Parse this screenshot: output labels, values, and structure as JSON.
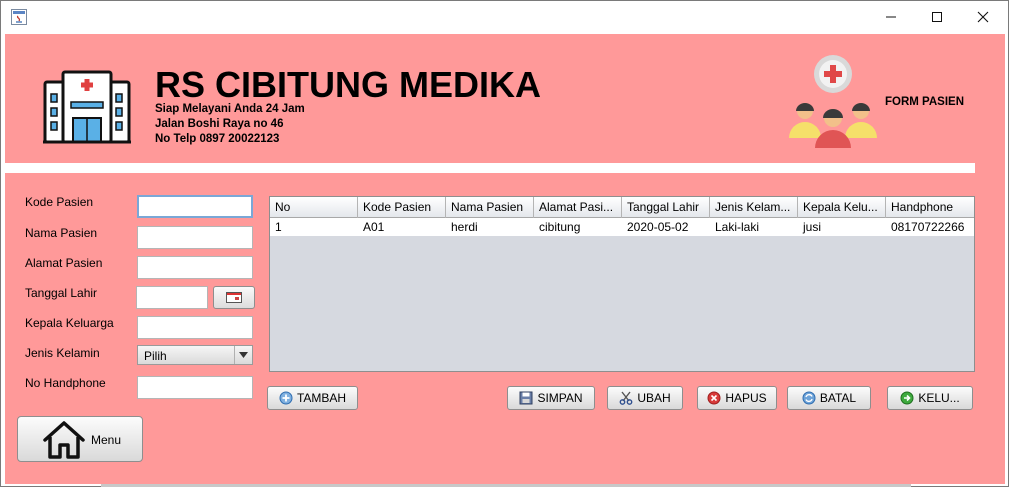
{
  "colors": {
    "panel": "#ff9999",
    "table_bg": "#d6d9e0"
  },
  "window": {
    "app_icon": "java-icon",
    "controls": [
      "minimize-icon",
      "maximize-icon",
      "close-icon"
    ]
  },
  "header": {
    "title": "RS CIBITUNG MEDIKA",
    "lines": [
      "Siap Melayani Anda 24 Jam",
      "Jalan Boshi Raya no 46",
      "No Telp 0897 20022123"
    ],
    "form_title": "FORM PASIEN",
    "logo_icon": "hospital-icon",
    "form_icon": "patients-icon"
  },
  "form": {
    "labels": {
      "kode": "Kode Pasien",
      "nama": "Nama Pasien",
      "alamat": "Alamat Pasien",
      "tanggal": "Tanggal Lahir",
      "kepala": "Kepala Keluarga",
      "jenis": "Jenis Kelamin",
      "hp": "No Handphone"
    },
    "values": {
      "kode": "",
      "nama": "",
      "alamat": "",
      "tanggal": "",
      "kepala": "",
      "hp": ""
    },
    "jenis_selected": "Pilih",
    "date_icon": "calendar-icon"
  },
  "table": {
    "columns": [
      "No",
      "Kode Pasien",
      "Nama Pasien",
      "Alamat Pasi...",
      "Tanggal Lahir",
      "Jenis Kelam...",
      "Kepala Kelu...",
      "Handphone"
    ],
    "rows": [
      [
        "1",
        "A01",
        "herdi",
        "cibitung",
        "2020-05-02",
        "Laki-laki",
        "jusi",
        "08170722266"
      ]
    ]
  },
  "buttons": {
    "tambah": "TAMBAH",
    "simpan": "SIMPAN",
    "ubah": "UBAH",
    "hapus": "HAPUS",
    "batal": "BATAL",
    "keluar": "KELU...",
    "menu": "Menu"
  }
}
